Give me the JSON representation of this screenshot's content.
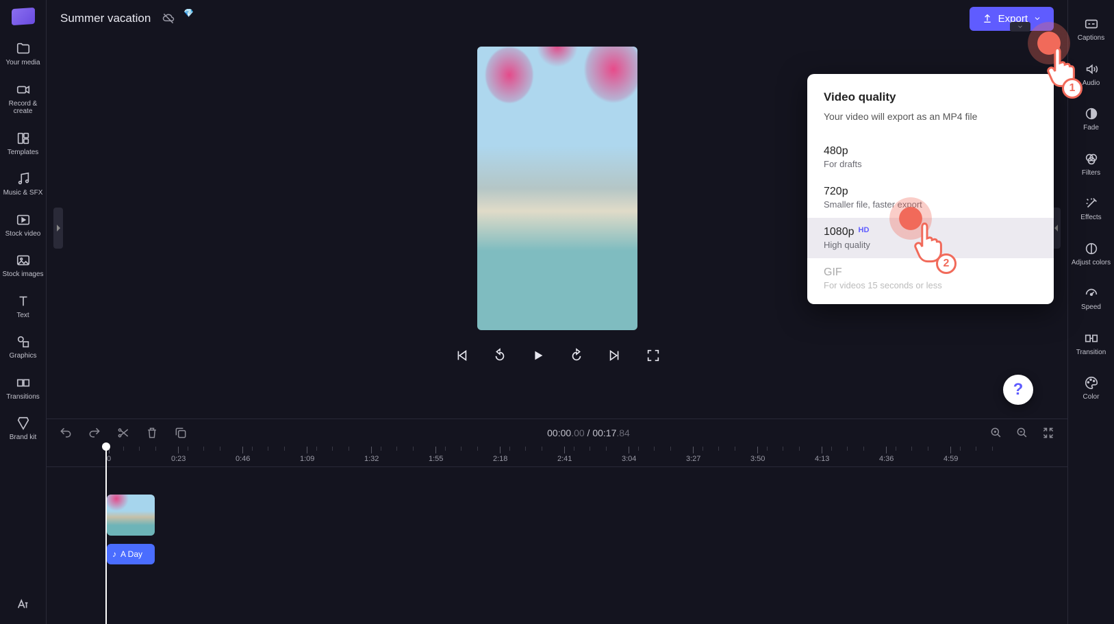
{
  "project_title": "Summer vacation",
  "export_button": "Export",
  "left_rail": [
    {
      "label": "Your media",
      "icon": "folder-icon"
    },
    {
      "label": "Record & create",
      "icon": "camera-icon"
    },
    {
      "label": "Templates",
      "icon": "templates-icon"
    },
    {
      "label": "Music & SFX",
      "icon": "music-icon"
    },
    {
      "label": "Stock video",
      "icon": "stock-video-icon"
    },
    {
      "label": "Stock images",
      "icon": "stock-images-icon"
    },
    {
      "label": "Text",
      "icon": "text-icon"
    },
    {
      "label": "Graphics",
      "icon": "graphics-icon"
    },
    {
      "label": "Transitions",
      "icon": "transitions-icon"
    },
    {
      "label": "Brand kit",
      "icon": "brand-kit-icon"
    }
  ],
  "right_rail": [
    {
      "label": "Captions",
      "icon": "captions-icon"
    },
    {
      "label": "Audio",
      "icon": "audio-icon"
    },
    {
      "label": "Fade",
      "icon": "fade-icon"
    },
    {
      "label": "Filters",
      "icon": "filters-icon"
    },
    {
      "label": "Effects",
      "icon": "effects-icon"
    },
    {
      "label": "Adjust colors",
      "icon": "adjust-colors-icon"
    },
    {
      "label": "Speed",
      "icon": "speed-icon"
    },
    {
      "label": "Transition",
      "icon": "transition-icon"
    },
    {
      "label": "Color",
      "icon": "color-icon"
    }
  ],
  "popup": {
    "title": "Video quality",
    "subtitle": "Your video will export as an MP4 file",
    "options": [
      {
        "label": "480p",
        "desc": "For drafts",
        "hd": false,
        "selected": false,
        "disabled": false
      },
      {
        "label": "720p",
        "desc": "Smaller file, faster export",
        "hd": false,
        "selected": false,
        "disabled": false
      },
      {
        "label": "1080p",
        "desc": "High quality",
        "hd": true,
        "selected": true,
        "disabled": false
      },
      {
        "label": "GIF",
        "desc": "For videos 15 seconds or less",
        "hd": false,
        "selected": false,
        "disabled": true
      }
    ]
  },
  "hd_badge": "HD",
  "tap_labels": {
    "one": "1",
    "two": "2"
  },
  "timecode": {
    "current": "00:00",
    "current_frac": ".00",
    "sep": " / ",
    "total": "00:17",
    "total_frac": ".84"
  },
  "ruler_ticks": [
    "0",
    "0:23",
    "0:46",
    "1:09",
    "1:32",
    "1:55",
    "2:18",
    "2:41",
    "3:04",
    "3:27",
    "3:50",
    "4:13",
    "4:36",
    "4:59"
  ],
  "audio_clip_label": "A Day",
  "help_label": "?"
}
